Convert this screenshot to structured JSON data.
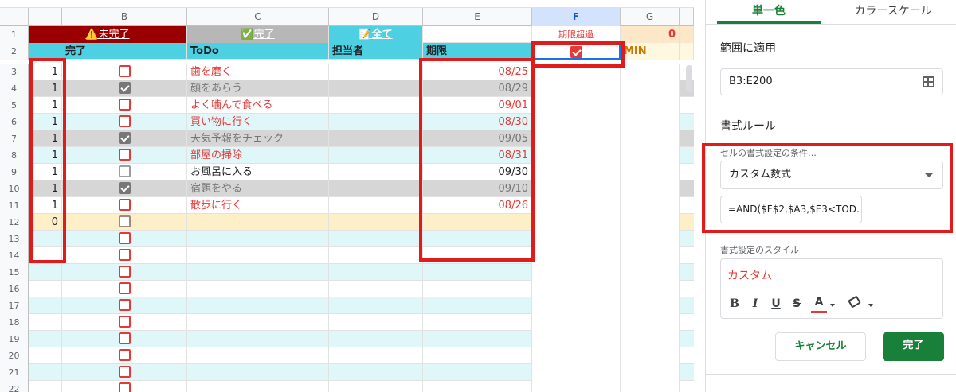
{
  "colors": {
    "red": "#e53935",
    "cyan": "#4dd0e1",
    "darkred": "#9b0000",
    "green": "#188038"
  },
  "columns": [
    "",
    "B",
    "C",
    "D",
    "E",
    "F",
    "G"
  ],
  "row1": {
    "num": "1",
    "incomplete": "⚠️未完了",
    "complete": "✅完了",
    "all": "📝全て",
    "overdue_label": "期限超過",
    "g_value": "0"
  },
  "row2": {
    "num": "2",
    "done": "完了",
    "todo": "ToDo",
    "owner": "担当者",
    "due": "期限",
    "min": "MIN"
  },
  "tasks": [
    {
      "row": "3",
      "count": "1",
      "state": "open",
      "task": "歯を磨く",
      "due": "08/25",
      "style": "red"
    },
    {
      "row": "4",
      "count": "1",
      "state": "checked",
      "task": "顔をあらう",
      "due": "08/29",
      "style": "gray"
    },
    {
      "row": "5",
      "count": "1",
      "state": "open",
      "task": "よく噛んで食べる",
      "due": "09/01",
      "style": "red"
    },
    {
      "row": "6",
      "count": "1",
      "state": "open",
      "task": "買い物に行く",
      "due": "08/30",
      "style": "red"
    },
    {
      "row": "7",
      "count": "1",
      "state": "checked",
      "task": "天気予報をチェック",
      "due": "09/05",
      "style": "gray"
    },
    {
      "row": "8",
      "count": "1",
      "state": "open",
      "task": "部屋の掃除",
      "due": "08/31",
      "style": "red"
    },
    {
      "row": "9",
      "count": "1",
      "state": "plain",
      "task": "お風呂に入る",
      "due": "09/30",
      "style": "black"
    },
    {
      "row": "10",
      "count": "1",
      "state": "checked",
      "task": "宿題をやる",
      "due": "09/10",
      "style": "gray"
    },
    {
      "row": "11",
      "count": "1",
      "state": "open",
      "task": "散歩に行く",
      "due": "08/26",
      "style": "red"
    },
    {
      "row": "12",
      "count": "0",
      "state": "brown",
      "task": "",
      "due": "",
      "style": "yellow"
    }
  ],
  "empty_rows": [
    "13",
    "14",
    "15",
    "16",
    "17",
    "18",
    "19",
    "20",
    "21",
    "22"
  ],
  "panel": {
    "tab_single": "単一色",
    "tab_scale": "カラースケール",
    "range_label": "範囲に適用",
    "range_value": "B3:E200",
    "rules_label": "書式ルール",
    "condition_label": "セルの書式設定の条件…",
    "condition_value": "カスタム数式",
    "formula_value": "=AND($F$2,$A3,$E3<TOD.",
    "style_label": "書式設定のスタイル",
    "style_value": "カスタム",
    "toolbar": {
      "bold": "B",
      "italic": "I",
      "underline": "U",
      "strike": "S",
      "textcolor": "A"
    },
    "cancel": "キャンセル",
    "done": "完了"
  }
}
